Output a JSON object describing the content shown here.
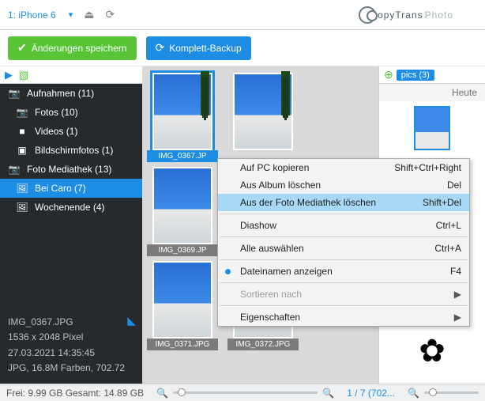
{
  "device": {
    "name": "1: iPhone 6"
  },
  "brand": {
    "bold": "opyTrans",
    "light": " Photo"
  },
  "actions": {
    "save": "Änderungen speichern",
    "backup": "Komplett-Backup"
  },
  "sidebar": {
    "items": [
      {
        "ico": "📷",
        "label": "Aufnahmen (11)"
      },
      {
        "ico": "📷",
        "label": "Fotos (10)"
      },
      {
        "ico": "■",
        "label": "Videos (1)"
      },
      {
        "ico": "▣",
        "label": "Bildschirmfotos (1)"
      },
      {
        "ico": "📷",
        "label": "Foto Mediathek (13)"
      },
      {
        "ico": "🖼",
        "label": "Bei Caro (7)"
      },
      {
        "ico": "🖼",
        "label": "Wochenende (4)"
      }
    ]
  },
  "info": {
    "name": "IMG_0367.JPG",
    "dim": "1536 x 2048 Pixel",
    "date": "27.03.2021 14:35:45",
    "fmt": "JPG, 16.8M Farben, 702.72"
  },
  "thumbs": [
    {
      "cap": "IMG_0367.JP",
      "sel": true,
      "tree": true
    },
    {
      "cap": "",
      "sel": false,
      "tree": true
    },
    {
      "cap": "IMG_0369.JP",
      "sel": false,
      "tree": false
    },
    {
      "cap": "",
      "sel": false,
      "tree": false
    },
    {
      "cap": "IMG_0371.JPG",
      "sel": false,
      "tree": false
    },
    {
      "cap": "IMG_0372.JPG",
      "sel": false,
      "tree": false
    }
  ],
  "right": {
    "pill": "pics (3)",
    "date": "Heute"
  },
  "ctx": [
    {
      "label": "Auf PC kopieren",
      "sc": "Shift+Ctrl+Right"
    },
    {
      "label": "Aus Album löschen",
      "sc": "Del"
    },
    {
      "label": "Aus der Foto Mediathek löschen",
      "sc": "Shift+Del",
      "hover": true
    },
    {
      "sep": true
    },
    {
      "label": "Diashow",
      "sc": "Ctrl+L"
    },
    {
      "sep": true
    },
    {
      "label": "Alle auswählen",
      "sc": "Ctrl+A"
    },
    {
      "sep": true
    },
    {
      "label": "Dateinamen anzeigen",
      "sc": "F4",
      "check": true
    },
    {
      "sep": true
    },
    {
      "label": "Sortieren nach",
      "arrow": true,
      "disabled": true
    },
    {
      "sep": true
    },
    {
      "label": "Eigenschaften",
      "arrow": true
    }
  ],
  "footer": {
    "storage": "Frei: 9.99 GB Gesamt: 14.89 GB",
    "count": "1 / 7 (702..."
  }
}
